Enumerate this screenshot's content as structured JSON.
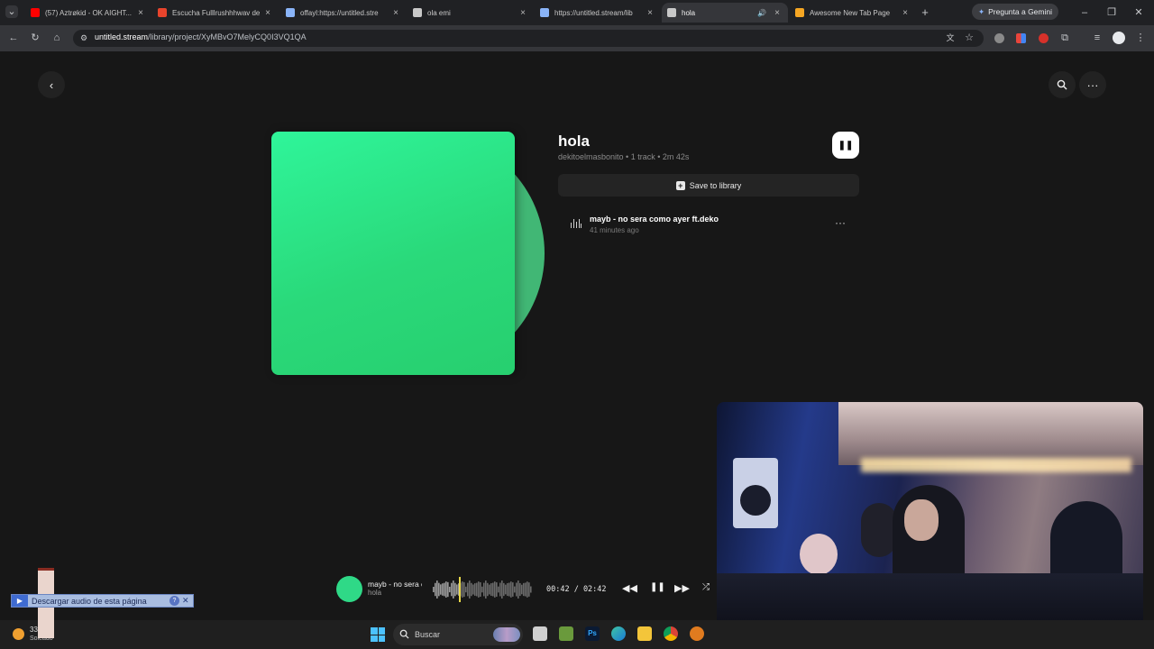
{
  "browser": {
    "tabs": [
      {
        "title": "(57) Aztrøkid - OK AIGHT...",
        "favicon_color": "#ff0000",
        "active": false,
        "audio": false
      },
      {
        "title": "Escucha Fulllrushhhwav de",
        "favicon_color": "#e8442c",
        "active": false,
        "audio": false
      },
      {
        "title": "offayl:https://untitled.stre",
        "favicon_color": "#8ab4f8",
        "active": false,
        "audio": false
      },
      {
        "title": "ola emi",
        "favicon_color": "#c8c8c8",
        "active": false,
        "audio": false
      },
      {
        "title": "https://untitled.stream/lib",
        "favicon_color": "#8ab4f8",
        "active": false,
        "audio": false
      },
      {
        "title": "hola",
        "favicon_color": "#c8c8c8",
        "active": true,
        "audio": true
      },
      {
        "title": "Awesome New Tab Page",
        "favicon_color": "#f5a623",
        "active": false,
        "audio": false
      }
    ],
    "gemini_label": "Pregunta a Gemini",
    "url_host": "untitled.stream",
    "url_path": "/library/project/XyMBvO7MelyCQ0I3VQ1QA",
    "icons": [
      "back-icon",
      "reload-icon",
      "home-icon",
      "site-info-icon",
      "translate-icon",
      "bookmark-star-icon",
      "extensions-icon",
      "profile-avatar"
    ]
  },
  "page": {
    "project_title": "hola",
    "meta": "dekitoelmasbonito • 1 track • 2m 42s",
    "save_label": "Save to library",
    "cover_color": "#2be083",
    "tracks": [
      {
        "title": "mayb - no sera como ayer ft.deko",
        "added": "41 minutes ago"
      }
    ]
  },
  "player": {
    "title": "mayb - no sera c",
    "subtitle": "hola",
    "time": "00:42  /  02:42",
    "progress": 0.26
  },
  "taskbar": {
    "search_label": "Buscar",
    "weather_temp": "33",
    "weather_desc": "Soleado",
    "download_label": "Descargar audio de esta página"
  },
  "colors": {
    "accent": "#2fd987",
    "background": "#171717",
    "chrome": "#202124"
  }
}
